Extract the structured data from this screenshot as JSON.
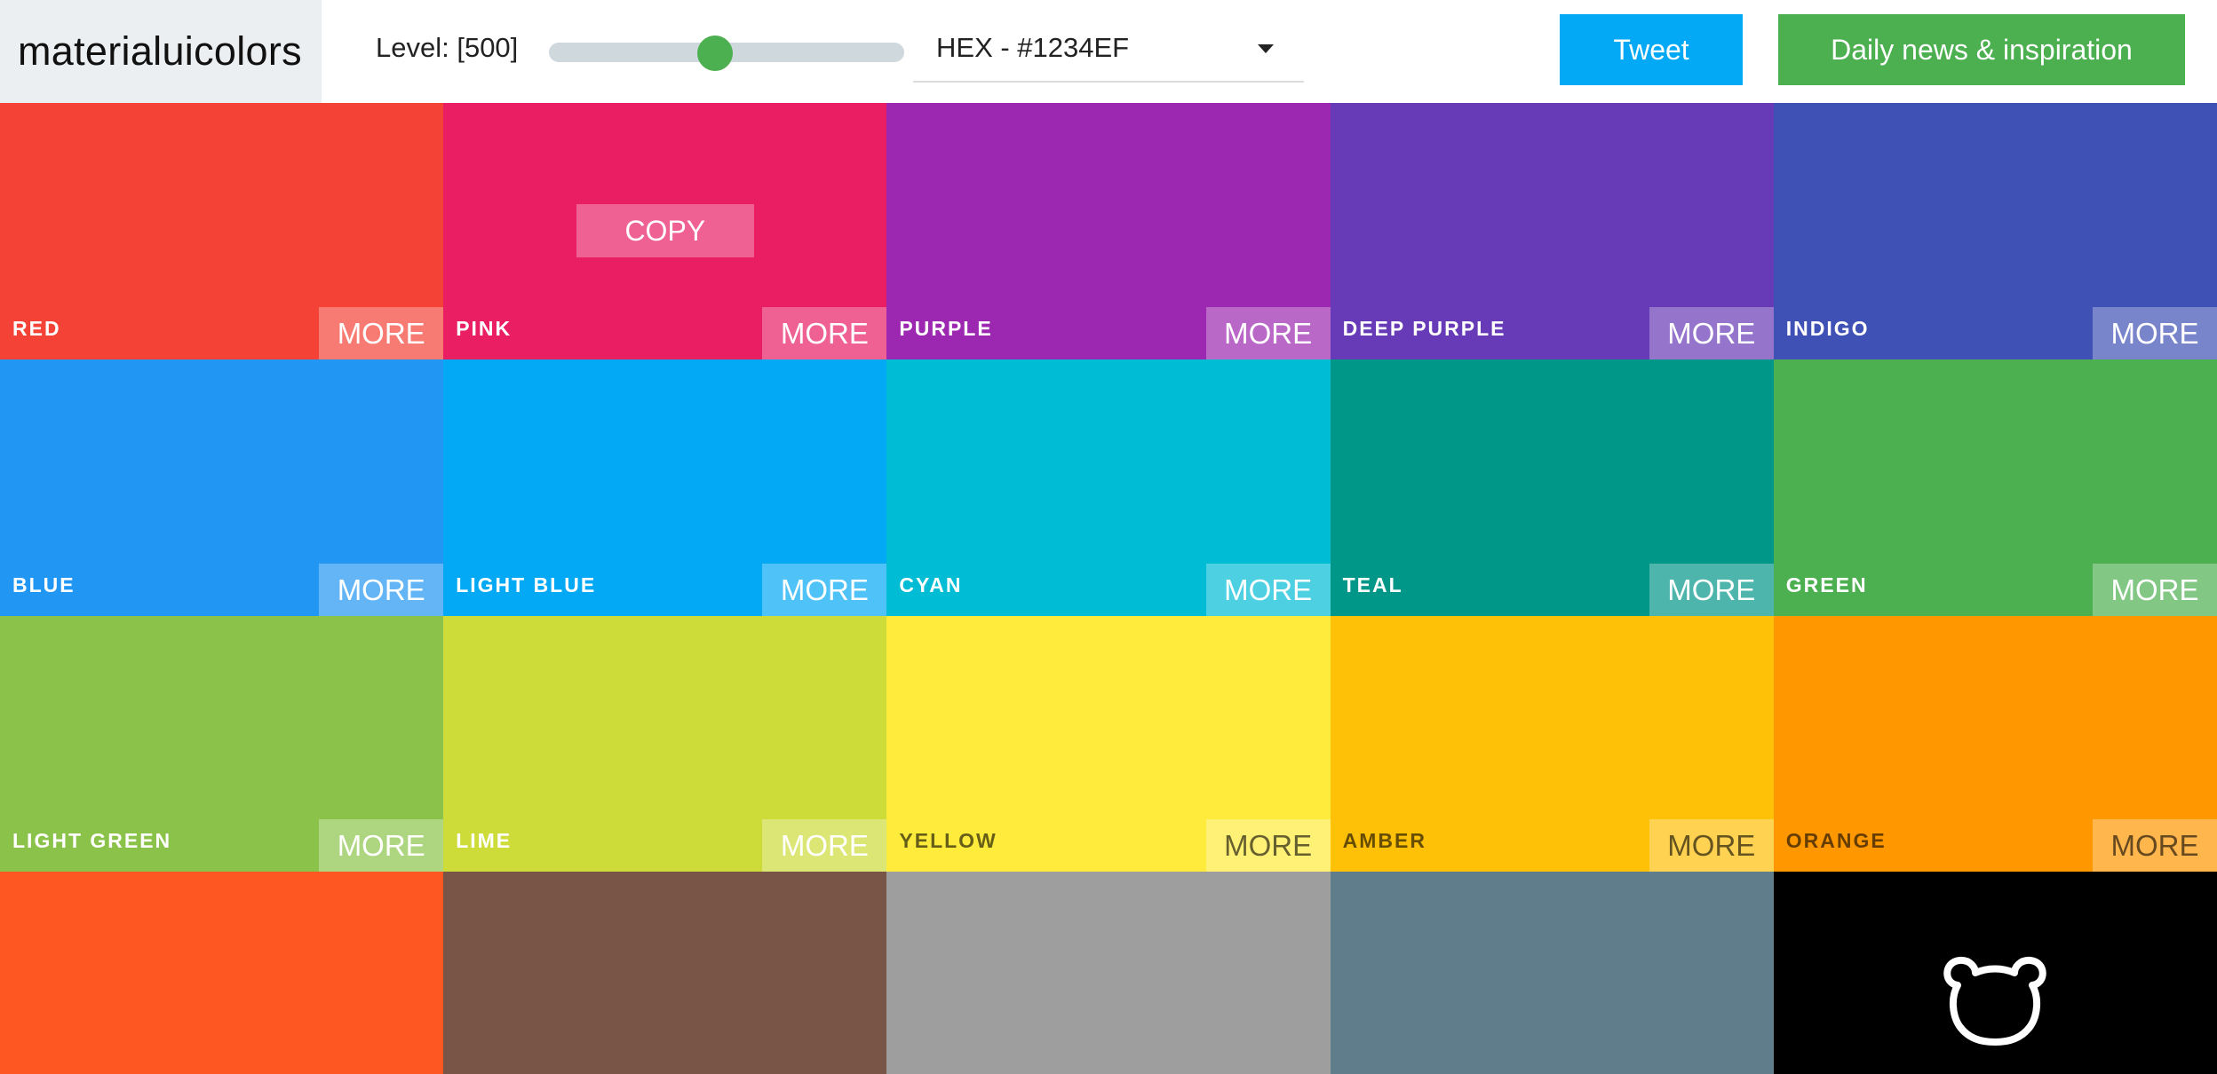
{
  "header": {
    "brand": "materialuicolors",
    "level_label": "Level: [500]",
    "slider": {
      "value": 500,
      "min": 50,
      "max": 900,
      "accent": "#4caf50"
    },
    "format_select": {
      "value": "HEX - #1234EF"
    },
    "tweet_label": "Tweet",
    "news_label": "Daily news & inspiration"
  },
  "swatches": [
    {
      "name": "RED",
      "color": "#f44336",
      "more": "MORE",
      "text": "light"
    },
    {
      "name": "PINK",
      "color": "#e91e63",
      "more": "MORE",
      "text": "light",
      "copy": "COPY"
    },
    {
      "name": "PURPLE",
      "color": "#9c27b0",
      "more": "MORE",
      "text": "light"
    },
    {
      "name": "DEEP PURPLE",
      "color": "#673ab7",
      "more": "MORE",
      "text": "light"
    },
    {
      "name": "INDIGO",
      "color": "#3f51b5",
      "more": "MORE",
      "text": "light"
    },
    {
      "name": "BLUE",
      "color": "#2196f3",
      "more": "MORE",
      "text": "light"
    },
    {
      "name": "LIGHT BLUE",
      "color": "#03a9f4",
      "more": "MORE",
      "text": "light"
    },
    {
      "name": "CYAN",
      "color": "#00bcd4",
      "more": "MORE",
      "text": "light"
    },
    {
      "name": "TEAL",
      "color": "#009688",
      "more": "MORE",
      "text": "light"
    },
    {
      "name": "GREEN",
      "color": "#4caf50",
      "more": "MORE",
      "text": "light"
    },
    {
      "name": "LIGHT GREEN",
      "color": "#8bc34a",
      "more": "MORE",
      "text": "light"
    },
    {
      "name": "LIME",
      "color": "#cddc39",
      "more": "MORE",
      "text": "light"
    },
    {
      "name": "YELLOW",
      "color": "#ffeb3b",
      "more": "MORE",
      "text": "dark"
    },
    {
      "name": "AMBER",
      "color": "#ffc107",
      "more": "MORE",
      "text": "dark"
    },
    {
      "name": "ORANGE",
      "color": "#ff9800",
      "more": "MORE",
      "text": "dark"
    },
    {
      "name": "",
      "color": "#ff5722",
      "text": "light"
    },
    {
      "name": "",
      "color": "#795548",
      "text": "light"
    },
    {
      "name": "",
      "color": "#9e9e9e",
      "text": "light"
    },
    {
      "name": "",
      "color": "#607d8b",
      "text": "light"
    },
    {
      "name": "",
      "color": "#000000",
      "text": "light",
      "icon": "bear-logo-icon"
    }
  ]
}
